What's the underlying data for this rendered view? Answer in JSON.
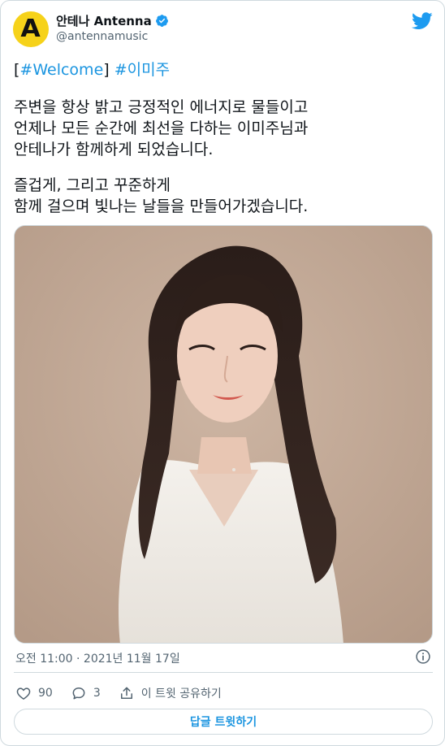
{
  "account": {
    "display_name": "안테나 Antenna",
    "handle": "@antennamusic",
    "avatar_letter": "A",
    "avatar_color": "#f6d21a",
    "verified": true
  },
  "tweet": {
    "bracket_open": "[",
    "hashtag_welcome": "#Welcome",
    "bracket_close": "]",
    "hashtag_name": "#이미주",
    "line1": "주변을 항상 밝고 긍정적인 에너지로 물들이고",
    "line2": "언제나 모든 순간에 최선을 다하는 이미주님과",
    "line3": "안테나가 함께하게 되었습니다.",
    "line4": "즐겁게, 그리고 꾸준하게",
    "line5": "함께 걸으며 빛나는 날들을 만들어가겠습니다."
  },
  "timestamp": "오전 11:00 · 2021년 11월 17일",
  "actions": {
    "likes": "90",
    "replies": "3",
    "share_label": "이 트윗 공유하기"
  },
  "reply_button_label": "답글 트윗하기",
  "colors": {
    "accent": "#1b95e0",
    "text": "#0f1419",
    "muted": "#536471",
    "border": "#cfd9de",
    "photo_background": "#bfa795"
  },
  "icons": {
    "brand": "twitter-bird-icon",
    "verified": "verified-badge-icon",
    "info": "info-icon",
    "like": "heart-icon",
    "reply": "comment-icon",
    "share": "share-icon"
  }
}
